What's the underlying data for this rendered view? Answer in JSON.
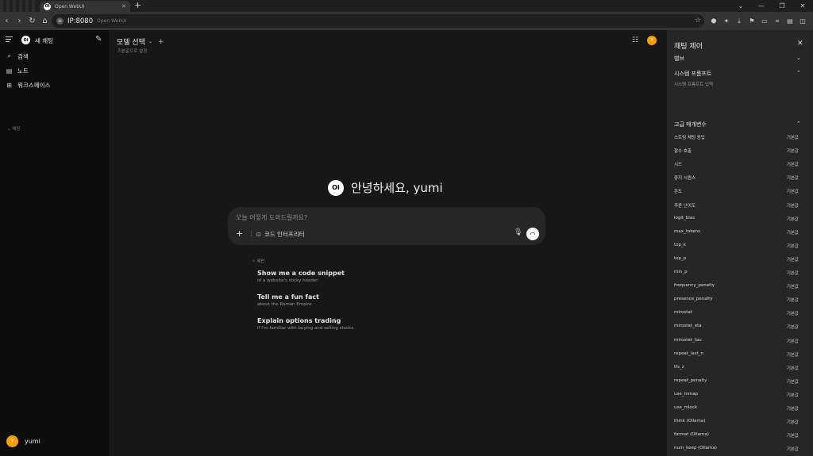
{
  "browser": {
    "tab_title": "Open WebUI",
    "new_tab": "+",
    "url": "IP:8080",
    "page_title": "Open WebUI"
  },
  "sidebar": {
    "new_chat": "새 채팅",
    "items": [
      {
        "label": "검색",
        "icon": "search-icon"
      },
      {
        "label": "노트",
        "icon": "note-icon"
      },
      {
        "label": "워크스페이스",
        "icon": "workspace-icon"
      }
    ],
    "section": "채팅",
    "user_initial": "Y",
    "user_name": "yumi"
  },
  "main": {
    "model_select": "모델 선택",
    "model_default": "기본값으로 설정",
    "avatar_initial": "Y",
    "logo_text": "OI",
    "greeting": "안녕하세요, yumi",
    "input_placeholder": "오늘 어떻게 도와드릴까요?",
    "code_interpreter": "코드 인터프리터",
    "suggestions_label": "제안",
    "suggestions": [
      {
        "title": "Show me a code snippet",
        "sub": "of a website's sticky header"
      },
      {
        "title": "Tell me a fun fact",
        "sub": "about the Roman Empire"
      },
      {
        "title": "Explain options trading",
        "sub": "if I'm familiar with buying and selling stocks"
      }
    ]
  },
  "panel": {
    "title": "채팅 제어",
    "valves": "밸브",
    "system_prompt": "시스템 프롬프트",
    "system_prompt_placeholder": "시스템 프롬프트 입력",
    "advanced_params": "고급 매개변수",
    "params": [
      {
        "name": "스트림 채팅 응답",
        "value": "기본값"
      },
      {
        "name": "함수 호출",
        "value": "기본값"
      },
      {
        "name": "시드",
        "value": "기본값"
      },
      {
        "name": "중지 시퀀스",
        "value": "기본값"
      },
      {
        "name": "온도",
        "value": "기본값"
      },
      {
        "name": "추론 난이도",
        "value": "기본값"
      },
      {
        "name": "logit_bias",
        "value": "기본값"
      },
      {
        "name": "max_tokens",
        "value": "기본값"
      },
      {
        "name": "top_k",
        "value": "기본값"
      },
      {
        "name": "top_p",
        "value": "기본값"
      },
      {
        "name": "min_p",
        "value": "기본값"
      },
      {
        "name": "frequency_penalty",
        "value": "기본값"
      },
      {
        "name": "presence_penalty",
        "value": "기본값"
      },
      {
        "name": "mirostat",
        "value": "기본값"
      },
      {
        "name": "mirostat_eta",
        "value": "기본값"
      },
      {
        "name": "mirostat_tau",
        "value": "기본값"
      },
      {
        "name": "repeat_last_n",
        "value": "기본값"
      },
      {
        "name": "tfs_z",
        "value": "기본값"
      },
      {
        "name": "repeat_penalty",
        "value": "기본값"
      },
      {
        "name": "use_mmap",
        "value": "기본값"
      },
      {
        "name": "use_mlock",
        "value": "기본값"
      },
      {
        "name": "think (Ollama)",
        "value": "기본값"
      },
      {
        "name": "format (Ollama)",
        "value": "기본값"
      },
      {
        "name": "num_keep (Ollama)",
        "value": "기본값"
      }
    ]
  },
  "colors": {
    "accent_avatar": "#f59e0b",
    "sidebar_bg": "#0d0d0d",
    "main_bg": "#171717",
    "panel_bg": "#262626"
  }
}
